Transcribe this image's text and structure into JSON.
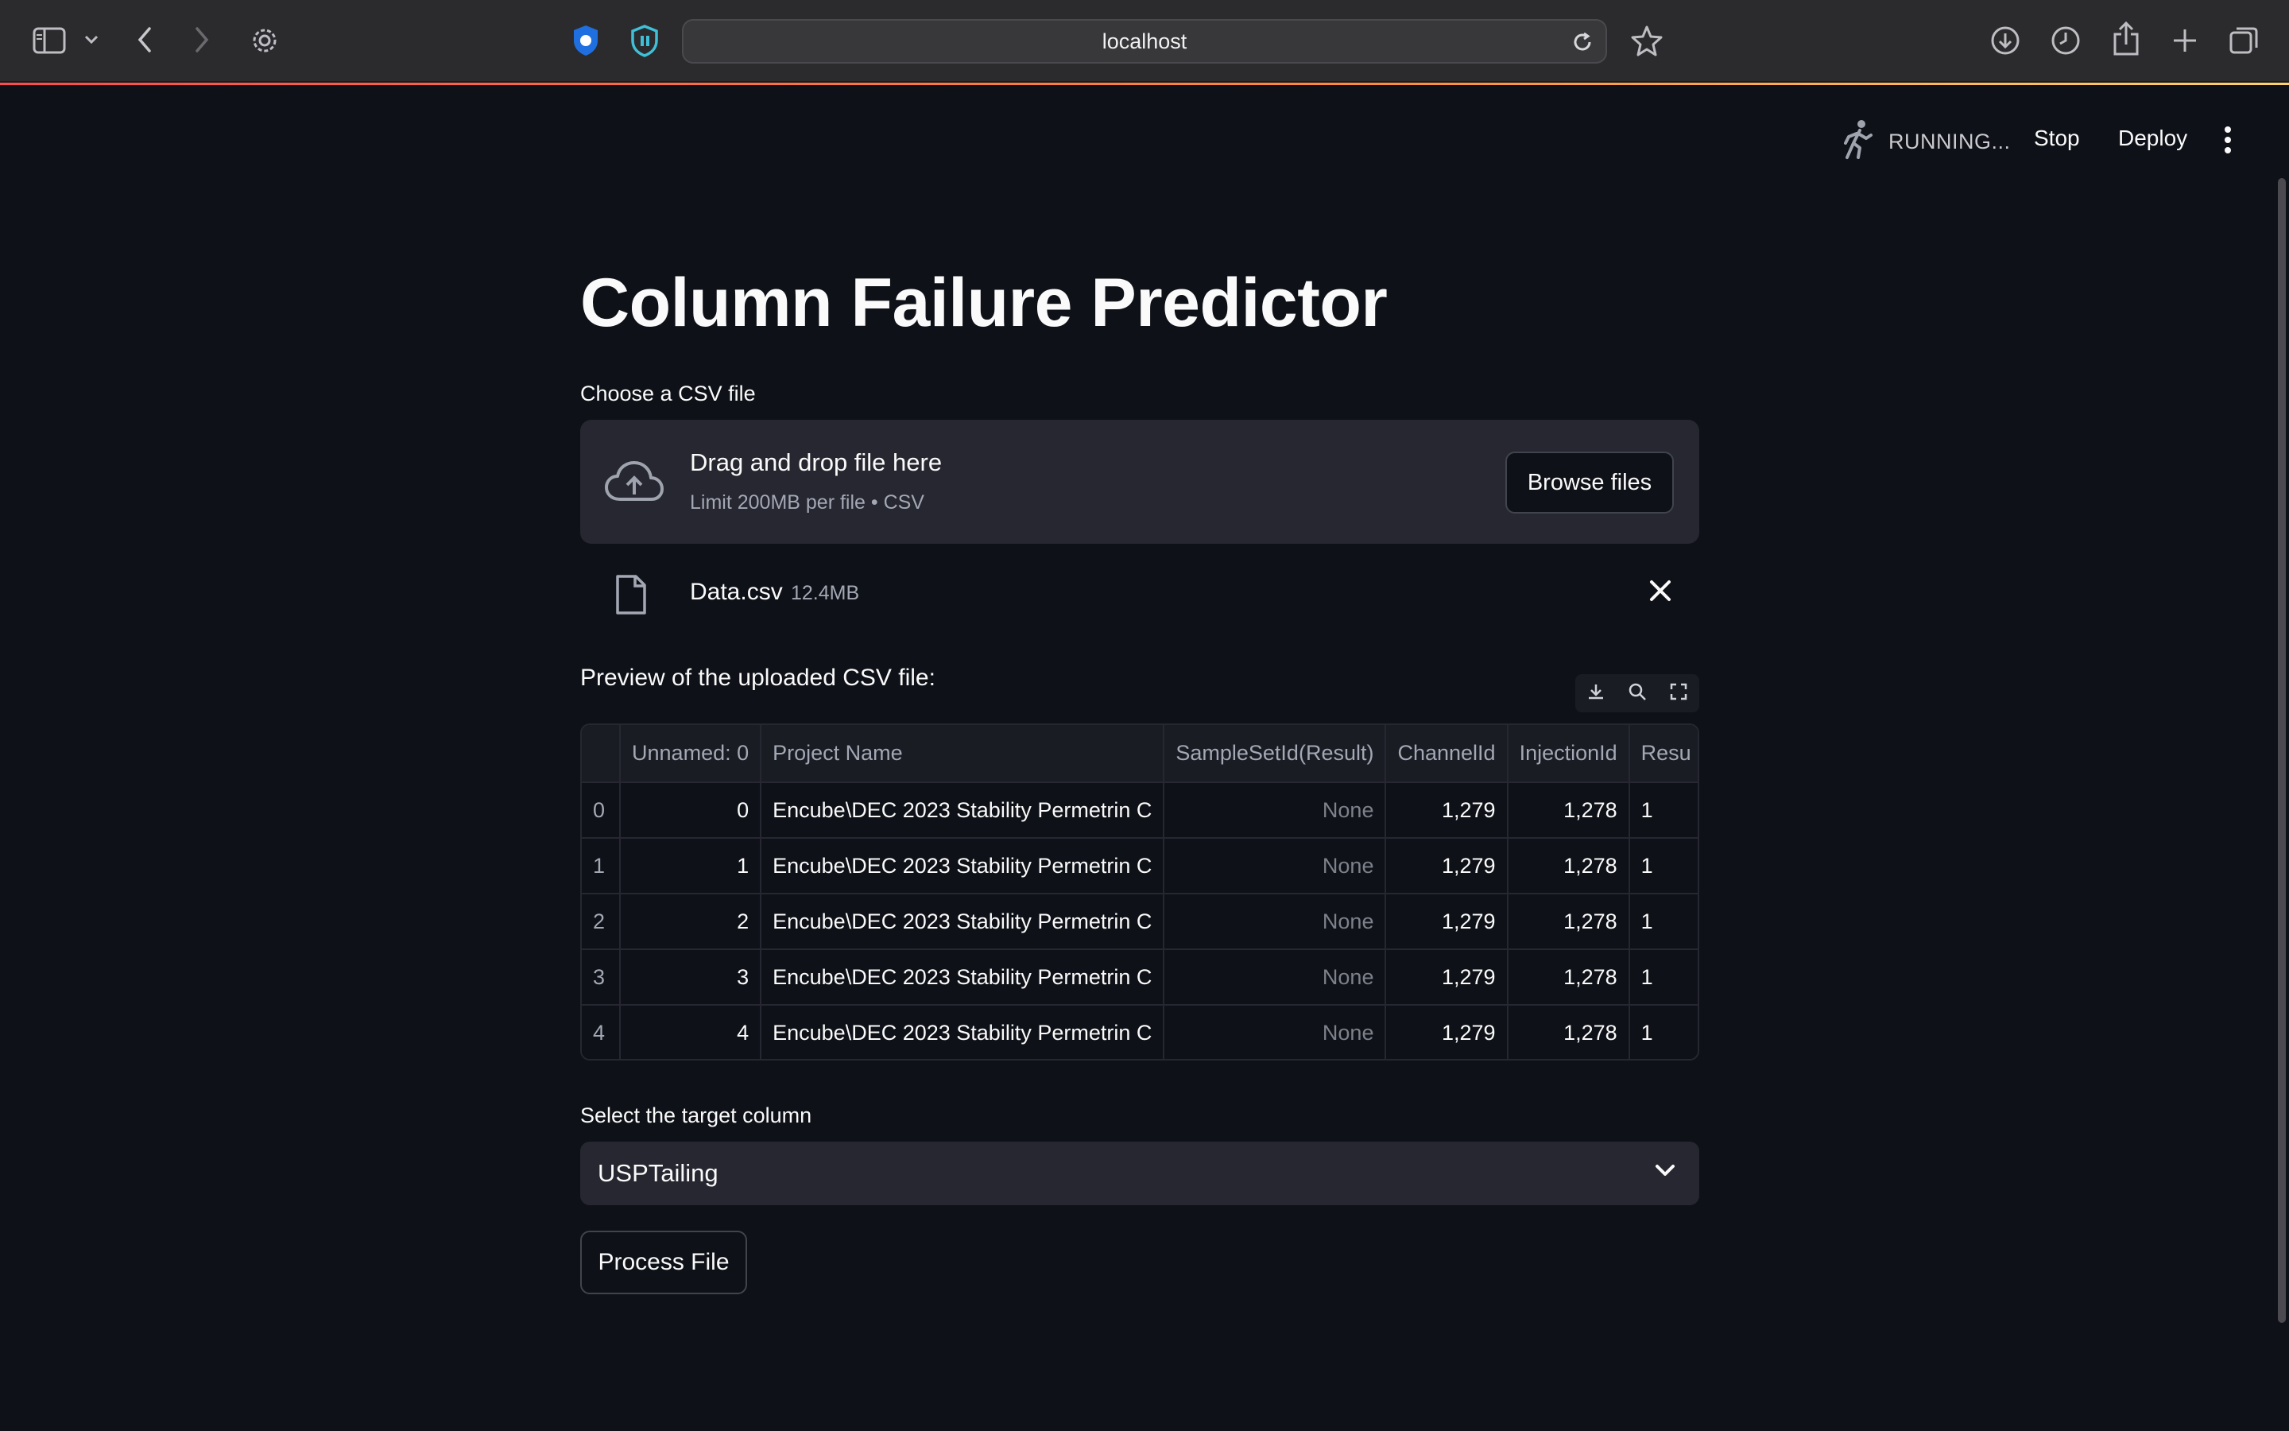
{
  "browser": {
    "url": "localhost",
    "icons": [
      "sidebar-icon",
      "chevron-down-icon",
      "back-icon",
      "forward-icon",
      "gear-icon",
      "shield-extension-icon",
      "password-extension-icon",
      "reload-icon",
      "star-icon",
      "download-icon",
      "history-icon",
      "share-icon",
      "plus-icon",
      "tabs-icon"
    ]
  },
  "header": {
    "status": "RUNNING...",
    "stop_label": "Stop",
    "deploy_label": "Deploy"
  },
  "main": {
    "title": "Column Failure Predictor",
    "uploader": {
      "label": "Choose a CSV file",
      "drop_title": "Drag and drop file here",
      "drop_sub": "Limit 200MB per file • CSV",
      "browse_label": "Browse files"
    },
    "uploaded_file": {
      "name": "Data.csv",
      "size": "12.4MB"
    },
    "preview_label": "Preview of the uploaded CSV file:",
    "table": {
      "columns": [
        "",
        "Unnamed: 0",
        "Project Name",
        "SampleSetId(Result)",
        "ChannelId",
        "InjectionId",
        "Resu"
      ],
      "rows": [
        [
          "0",
          "0",
          "Encube\\DEC 2023 Stability Permetrin C",
          "None",
          "1,279",
          "1,278",
          "1"
        ],
        [
          "1",
          "1",
          "Encube\\DEC 2023 Stability Permetrin C",
          "None",
          "1,279",
          "1,278",
          "1"
        ],
        [
          "2",
          "2",
          "Encube\\DEC 2023 Stability Permetrin C",
          "None",
          "1,279",
          "1,278",
          "1"
        ],
        [
          "3",
          "3",
          "Encube\\DEC 2023 Stability Permetrin C",
          "None",
          "1,279",
          "1,278",
          "1"
        ],
        [
          "4",
          "4",
          "Encube\\DEC 2023 Stability Permetrin C",
          "None",
          "1,279",
          "1,278",
          "1"
        ]
      ]
    },
    "target": {
      "label": "Select the target column",
      "selected": "USPTailing"
    },
    "process_label": "Process File"
  },
  "colors": {
    "background": "#0e1117",
    "surface": "#262730",
    "accent": "#ff4b4b",
    "chrome": "#2b2b2e"
  }
}
